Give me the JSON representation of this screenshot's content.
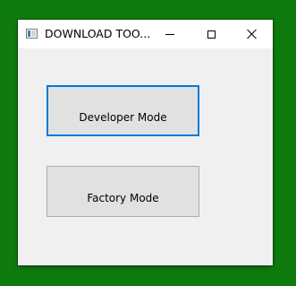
{
  "window": {
    "title": "DOWNLOAD TOO...",
    "controls": {
      "minimize_icon": "minimize-icon",
      "maximize_icon": "maximize-icon",
      "close_icon": "close-icon"
    }
  },
  "buttons": {
    "developer_mode": "Developer Mode",
    "factory_mode": "Factory Mode"
  },
  "colors": {
    "desktop": "#0f7b0f",
    "window_bg": "#f0f0f0",
    "focus_border": "#0078d7"
  }
}
